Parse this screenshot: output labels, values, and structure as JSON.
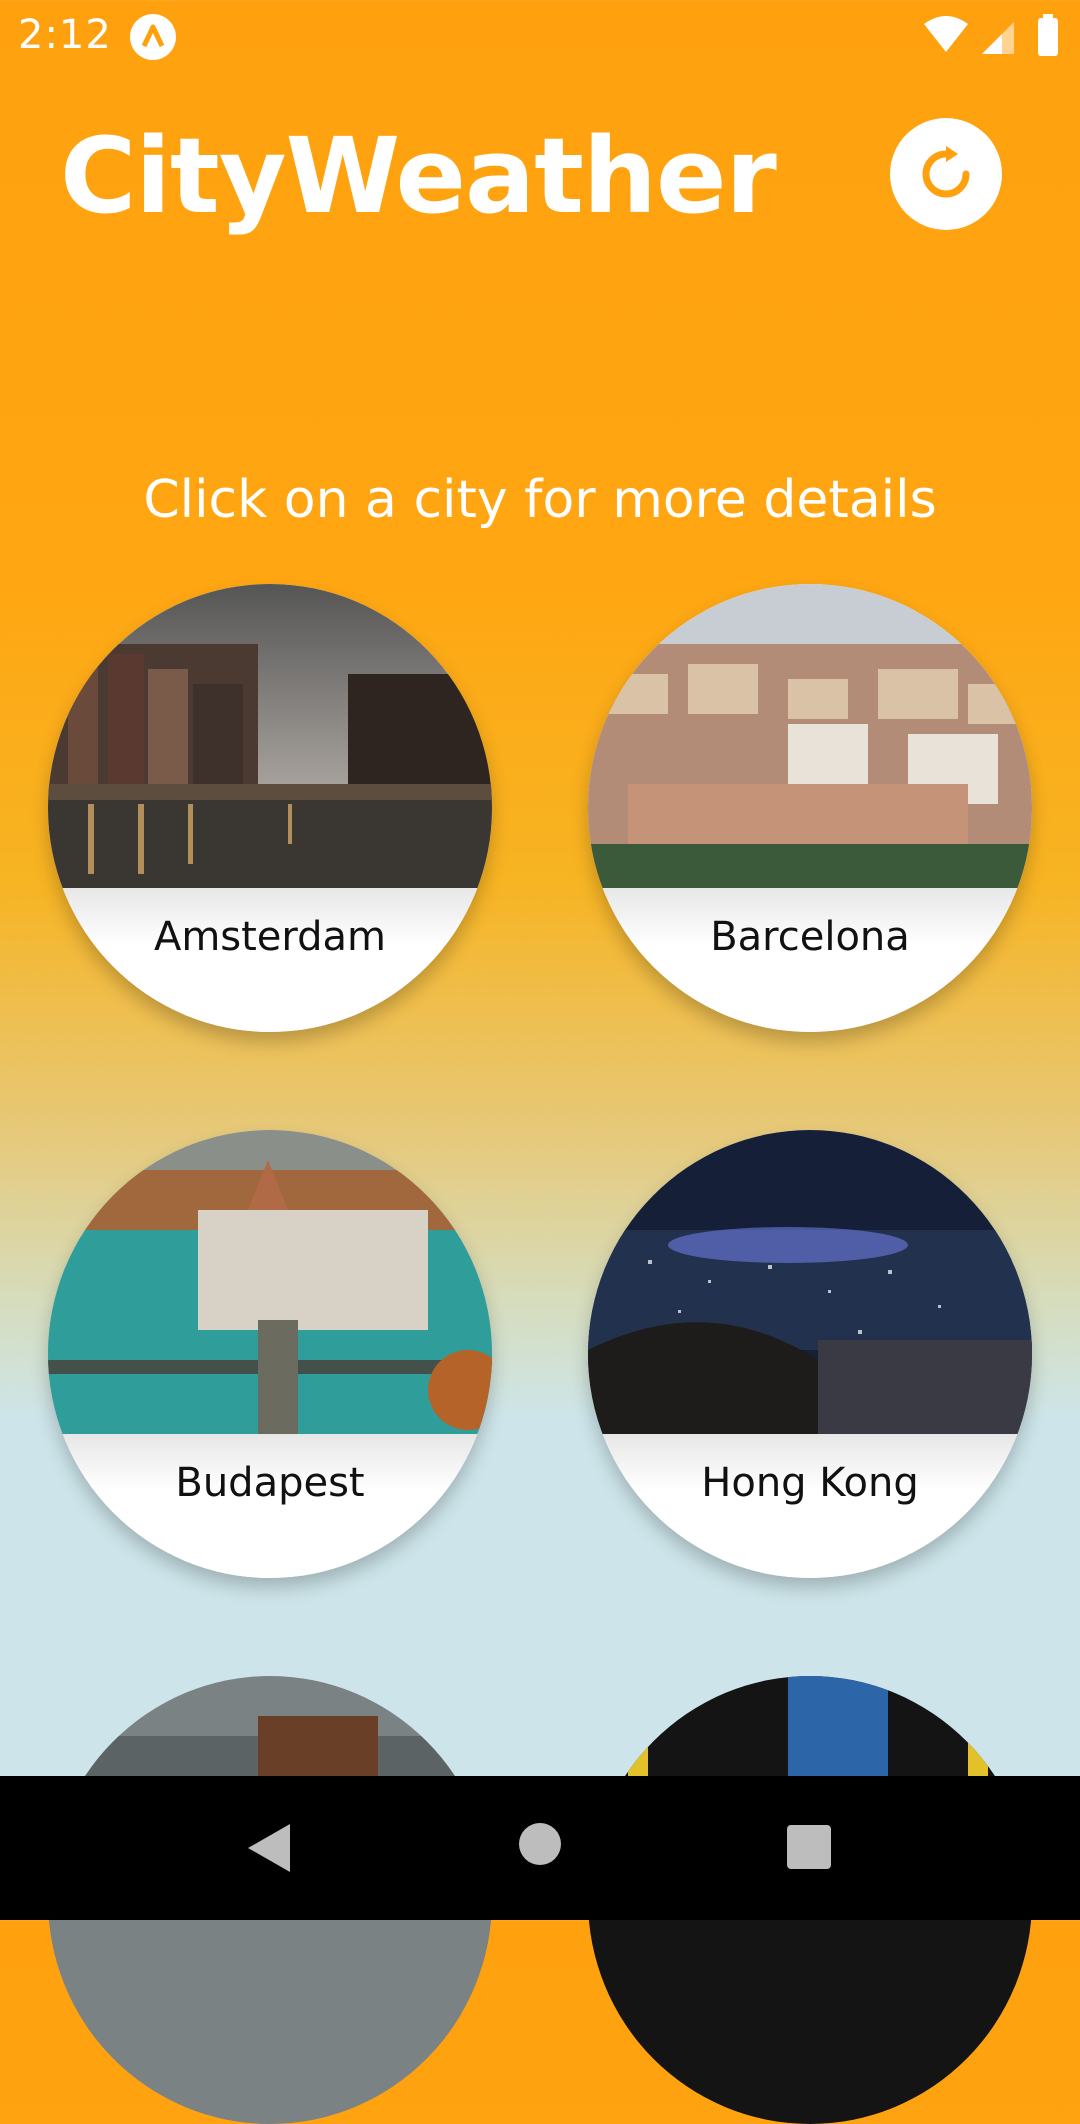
{
  "status_bar": {
    "time": "2:12"
  },
  "header": {
    "title": "CityWeather",
    "refresh_icon": "refresh-icon"
  },
  "subtitle": "Click on a city for more details",
  "cities": [
    {
      "name": "Amsterdam"
    },
    {
      "name": "Barcelona"
    },
    {
      "name": "Budapest"
    },
    {
      "name": "Hong Kong"
    }
  ],
  "nav": {
    "icons": [
      "back-icon",
      "home-icon",
      "recents-icon"
    ]
  },
  "colors": {
    "accent": "#FFA10F",
    "background_bottom": "#CDE5EA",
    "text_light": "#FFFFFF"
  }
}
